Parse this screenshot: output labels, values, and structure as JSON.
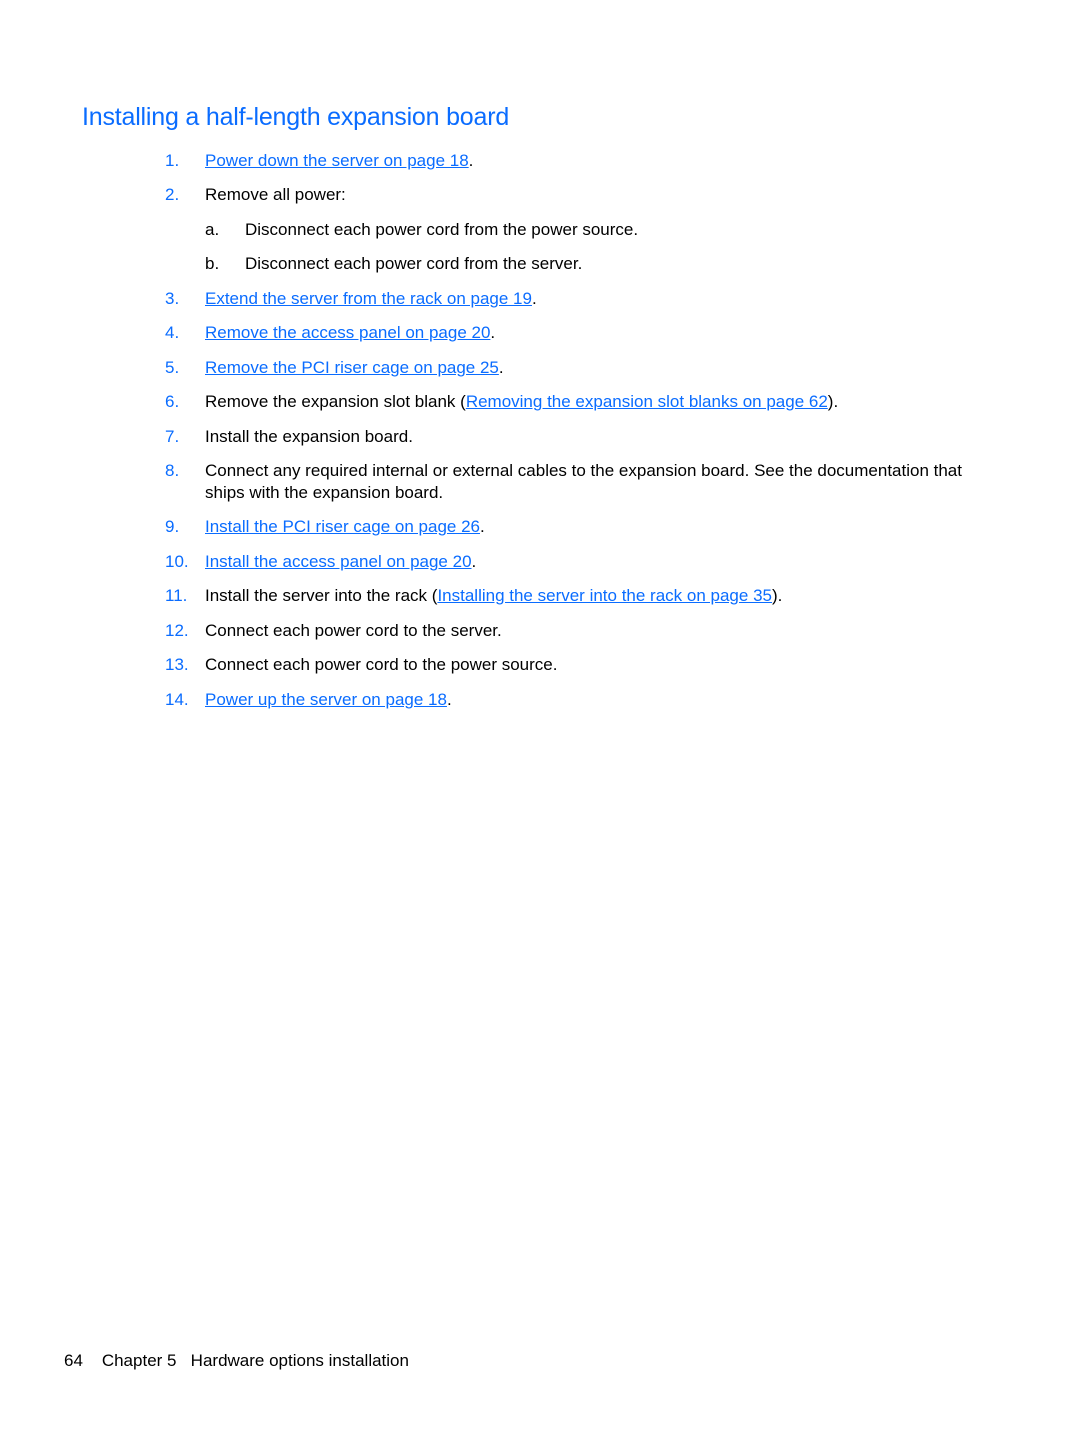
{
  "page": {
    "title": "Installing a half-length expansion board",
    "colors": {
      "accent": "#0a6cff",
      "text": "#000000"
    }
  },
  "steps": [
    {
      "num": "1.",
      "link": "Power down the server on page 18",
      "after": "."
    },
    {
      "num": "2.",
      "text": "Remove all power:"
    },
    {
      "num": "3.",
      "link": "Extend the server from the rack on page 19",
      "after": "."
    },
    {
      "num": "4.",
      "link": "Remove the access panel on page 20",
      "after": "."
    },
    {
      "num": "5.",
      "link": "Remove the PCI riser cage on page 25",
      "after": "."
    },
    {
      "num": "6.",
      "text": "Remove the expansion slot blank (",
      "link": "Removing the expansion slot blanks on page 62",
      "after": ")."
    },
    {
      "num": "7.",
      "text": "Install the expansion board."
    },
    {
      "num": "8.",
      "text": "Connect any required internal or external cables to the expansion board. See the documentation that ships with the expansion board."
    },
    {
      "num": "9.",
      "link": "Install the PCI riser cage on page 26",
      "after": "."
    },
    {
      "num": "10.",
      "link": "Install the access panel on page 20",
      "after": "."
    },
    {
      "num": "11.",
      "text": "Install the server into the rack (",
      "link": "Installing the server into the rack on page 35",
      "after": ")."
    },
    {
      "num": "12.",
      "text": "Connect each power cord to the server."
    },
    {
      "num": "13.",
      "text": "Connect each power cord to the power source."
    },
    {
      "num": "14.",
      "link": "Power up the server on page 18",
      "after": "."
    }
  ],
  "substeps": [
    {
      "num": "a.",
      "text": "Disconnect each power cord from the power source."
    },
    {
      "num": "b.",
      "text": "Disconnect each power cord from the server."
    }
  ],
  "footer": {
    "page_number": "64",
    "chapter": "Chapter 5",
    "section": "Hardware options installation"
  }
}
